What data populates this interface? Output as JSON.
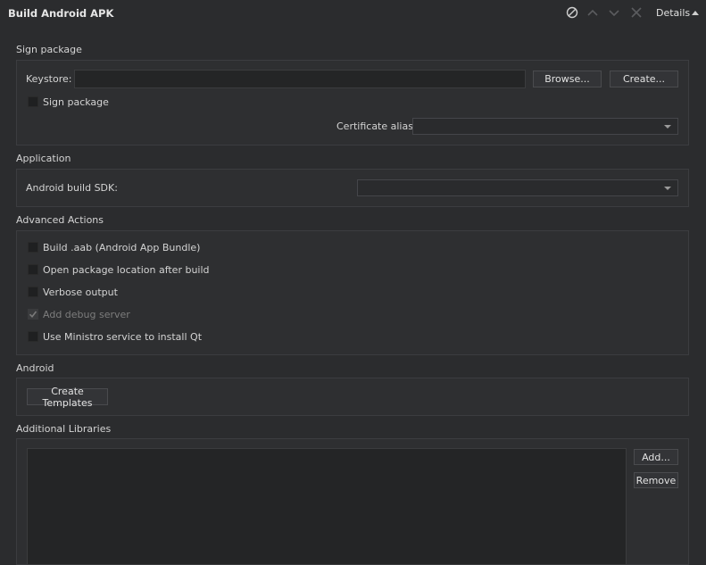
{
  "header": {
    "title": "Build Android APK",
    "details_label": "Details",
    "icons": [
      "disable-icon",
      "chevron-up-icon",
      "chevron-down-icon",
      "close-icon"
    ]
  },
  "sign_package": {
    "section_title": "Sign package",
    "keystore_label": "Keystore:",
    "keystore_value": "",
    "browse_label": "Browse...",
    "create_label": "Create...",
    "sign_checkbox_label": "Sign package",
    "sign_checked": false,
    "certificate_alias_label": "Certificate alias:",
    "certificate_alias_value": ""
  },
  "application": {
    "section_title": "Application",
    "sdk_label": "Android build SDK:",
    "sdk_value": ""
  },
  "advanced_actions": {
    "section_title": "Advanced Actions",
    "options": [
      {
        "label": "Build .aab (Android App Bundle)",
        "checked": false,
        "disabled": false
      },
      {
        "label": "Open package location after build",
        "checked": false,
        "disabled": false
      },
      {
        "label": "Verbose output",
        "checked": false,
        "disabled": false
      },
      {
        "label": "Add debug server",
        "checked": true,
        "disabled": true
      },
      {
        "label": "Use Ministro service to install Qt",
        "checked": false,
        "disabled": false
      }
    ]
  },
  "android": {
    "section_title": "Android",
    "create_templates_label": "Create Templates"
  },
  "additional_libraries": {
    "section_title": "Additional Libraries",
    "add_label": "Add...",
    "remove_label": "Remove",
    "items": []
  }
}
